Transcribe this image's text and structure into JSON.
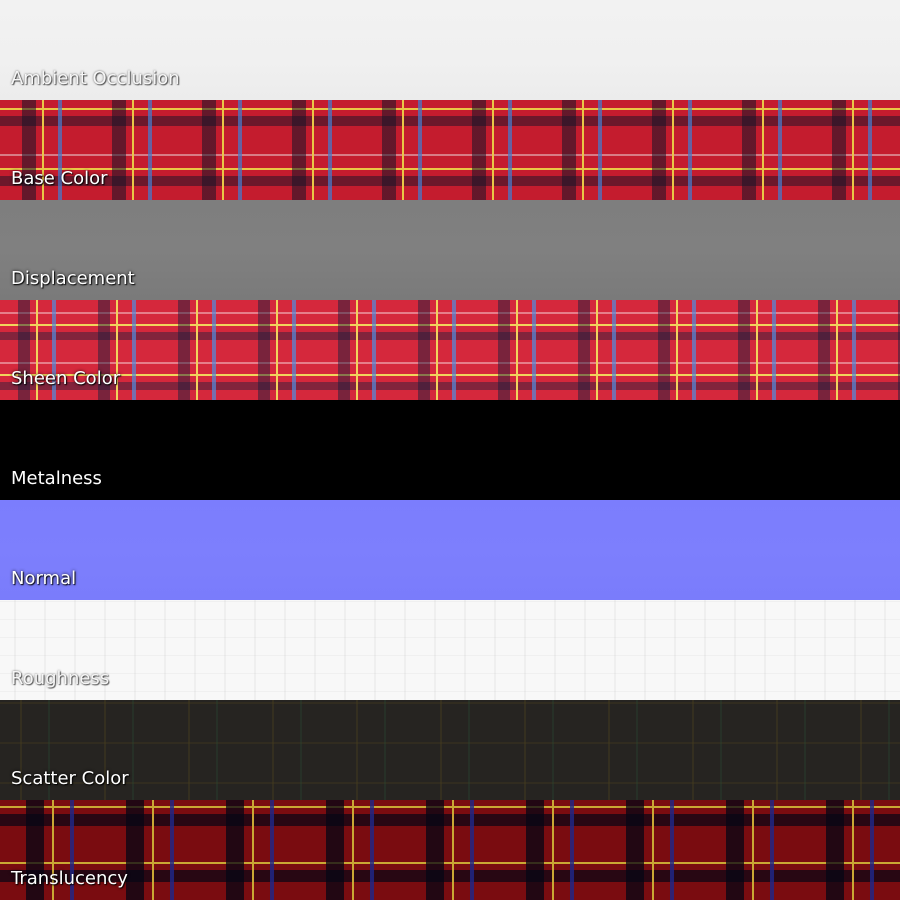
{
  "maps": [
    {
      "label": "Ambient Occlusion",
      "color": "#f0f0f0"
    },
    {
      "label": "Base Color",
      "color": "#c41c2e"
    },
    {
      "label": "Displacement",
      "color": "#7e7e7e"
    },
    {
      "label": "Sheen Color",
      "color": "#d5283c"
    },
    {
      "label": "Metalness",
      "color": "#000000"
    },
    {
      "label": "Normal",
      "color": "#7b7dfd"
    },
    {
      "label": "Roughness",
      "color": "#f8f8f8"
    },
    {
      "label": "Scatter Color",
      "color": "#262421"
    },
    {
      "label": "Translucency",
      "color": "#7a0c10"
    }
  ]
}
